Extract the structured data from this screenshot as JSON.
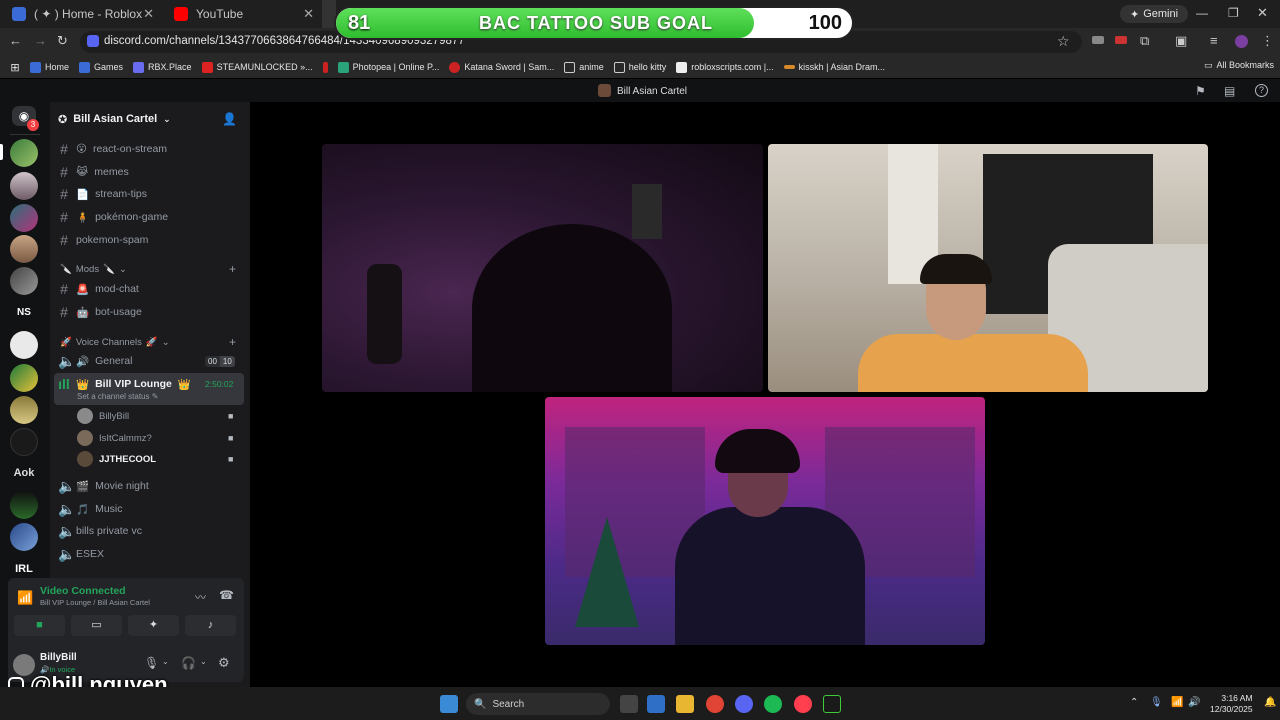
{
  "browser": {
    "tabs": [
      {
        "label": "( ✦ ) Home - Roblox"
      },
      {
        "label": "YouTube"
      }
    ],
    "gemini_label": "Gemini",
    "url": "discord.com/channels/1343770663864766484/1433409689093279877",
    "bookmarks": [
      "Home",
      "Games",
      "RBX.Place",
      "STEAMUNLOCKED »...",
      "Photopea | Online P...",
      "Katana Sword | Sam...",
      "anime",
      "hello kitty",
      "robloxscripts.com |...",
      "kisskh | Asian Dram..."
    ],
    "all_bookmarks_label": "All Bookmarks"
  },
  "overlay": {
    "goal_current": "81",
    "goal_target": "100",
    "goal_title": "BAC TATTOO SUB GOAL",
    "goal_progress": 0.81,
    "handle": "@bill.nguyen"
  },
  "discord": {
    "window_title": "Bill Asian Cartel",
    "server_name": "Bill Asian Cartel",
    "mention_badge": "3",
    "text_channels": [
      {
        "label": "react-on-stream",
        "emoji": "😮"
      },
      {
        "label": "memes",
        "emoji": "😹"
      },
      {
        "label": "stream-tips",
        "emoji": "📄"
      },
      {
        "label": "pokémon-game",
        "emoji": "🧍"
      },
      {
        "label": "pokemon-spam",
        "emoji": ""
      }
    ],
    "mods_category": "Mods",
    "mod_channels": [
      {
        "label": "mod-chat",
        "emoji": "🚨"
      },
      {
        "label": "bot-usage",
        "emoji": "🤖"
      }
    ],
    "voice_category": "Voice Channels",
    "general_label": "General",
    "general_count": "00",
    "general_limit": "10",
    "vip_label": "Bill VIP Lounge",
    "vip_timer": "2:50:02",
    "vip_status": "Set a channel status",
    "vip_members": [
      "BillyBill",
      "IsItCalmmz?",
      "JJTHECOOL"
    ],
    "other_voice": [
      "Movie night",
      "Music",
      "bills private vc",
      "ESEX"
    ],
    "connection": {
      "status": "Video Connected",
      "detail": "Bill VIP Lounge / Bill Asian Cartel"
    },
    "user": {
      "name": "BillyBill",
      "status": "In voice"
    },
    "server_labels": [
      "NS",
      "Aok",
      "IRL"
    ]
  },
  "taskbar": {
    "search_placeholder": "Search",
    "time": "3:16 AM",
    "date": "12/30/2025"
  },
  "colors": {
    "accent_green": "#23a55a",
    "discord_bg": "#1b1b1e",
    "goal_fill": "#3ecb3a"
  }
}
